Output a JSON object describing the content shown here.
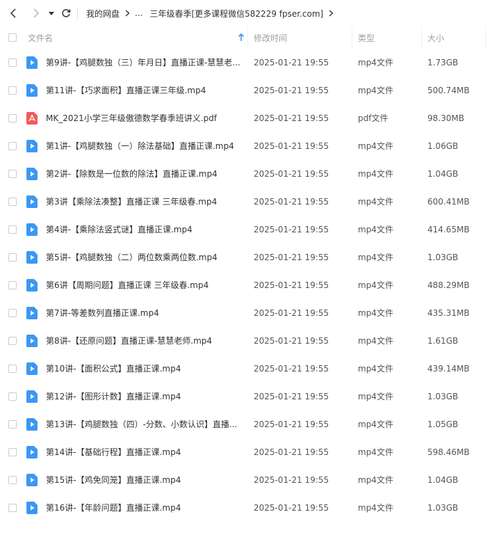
{
  "breadcrumb": {
    "root": "我的网盘",
    "ellipsis": "...",
    "current": "三年级春季[更多课程微信582229 fpser.com]"
  },
  "columns": {
    "name": "文件名",
    "modified": "修改时间",
    "type": "类型",
    "size": "大小"
  },
  "colors": {
    "mp4_icon": "#3b97f5",
    "pdf_icon": "#f05a5a"
  },
  "files": [
    {
      "name": "第9讲-【鸡腿数独（三）年月日】直播正课-慧慧老...",
      "modified": "2025-01-21 19:55",
      "type": "mp4文件",
      "size": "1.73GB",
      "icon": "video-file-icon"
    },
    {
      "name": "第11讲-【巧求面积】直播正课三年级.mp4",
      "modified": "2025-01-21 19:55",
      "type": "mp4文件",
      "size": "500.74MB",
      "icon": "video-file-icon"
    },
    {
      "name": "MK_2021小学三年级傲德数学春季班讲义.pdf",
      "modified": "2025-01-21 19:55",
      "type": "pdf文件",
      "size": "98.30MB",
      "icon": "pdf-file-icon"
    },
    {
      "name": "第1讲-【鸡腿数独（一）除法基础】直播正课.mp4",
      "modified": "2025-01-21 19:55",
      "type": "mp4文件",
      "size": "1.06GB",
      "icon": "video-file-icon"
    },
    {
      "name": "第2讲-【除数是一位数的除法】直播正课.mp4",
      "modified": "2025-01-21 19:55",
      "type": "mp4文件",
      "size": "1.04GB",
      "icon": "video-file-icon"
    },
    {
      "name": "第3讲【乘除法凑整】直播正课 三年级春.mp4",
      "modified": "2025-01-21 19:55",
      "type": "mp4文件",
      "size": "600.41MB",
      "icon": "video-file-icon"
    },
    {
      "name": "第4讲-【乘除法竖式谜】直播正课.mp4",
      "modified": "2025-01-21 19:55",
      "type": "mp4文件",
      "size": "414.65MB",
      "icon": "video-file-icon"
    },
    {
      "name": "第5讲-【鸡腿数独（二）两位数乘两位数.mp4",
      "modified": "2025-01-21 19:55",
      "type": "mp4文件",
      "size": "1.03GB",
      "icon": "video-file-icon"
    },
    {
      "name": "第6讲【周期问题】直播正课 三年级春.mp4",
      "modified": "2025-01-21 19:55",
      "type": "mp4文件",
      "size": "488.29MB",
      "icon": "video-file-icon"
    },
    {
      "name": "第7讲-等差数列直播正课.mp4",
      "modified": "2025-01-21 19:55",
      "type": "mp4文件",
      "size": "435.31MB",
      "icon": "video-file-icon"
    },
    {
      "name": "第8讲-【还原问题】直播正课-慧慧老师.mp4",
      "modified": "2025-01-21 19:55",
      "type": "mp4文件",
      "size": "1.61GB",
      "icon": "video-file-icon"
    },
    {
      "name": "第10讲-【面积公式】直播正课.mp4",
      "modified": "2025-01-21 19:55",
      "type": "mp4文件",
      "size": "439.14MB",
      "icon": "video-file-icon"
    },
    {
      "name": "第12讲-【图形计数】直播正课.mp4",
      "modified": "2025-01-21 19:55",
      "type": "mp4文件",
      "size": "1.03GB",
      "icon": "video-file-icon"
    },
    {
      "name": "第13讲-【鸡腿数独（四）-分数、小数认识】直播...",
      "modified": "2025-01-21 19:55",
      "type": "mp4文件",
      "size": "1.05GB",
      "icon": "video-file-icon"
    },
    {
      "name": "第14讲-【基础行程】直播正课.mp4",
      "modified": "2025-01-21 19:55",
      "type": "mp4文件",
      "size": "598.46MB",
      "icon": "video-file-icon"
    },
    {
      "name": "第15讲-【鸡免同笼】直播正课.mp4",
      "modified": "2025-01-21 19:55",
      "type": "mp4文件",
      "size": "1.04GB",
      "icon": "video-file-icon"
    },
    {
      "name": "第16讲-【年龄问题】直播正课.mp4",
      "modified": "2025-01-21 19:55",
      "type": "mp4文件",
      "size": "1.03GB",
      "icon": "video-file-icon"
    }
  ]
}
